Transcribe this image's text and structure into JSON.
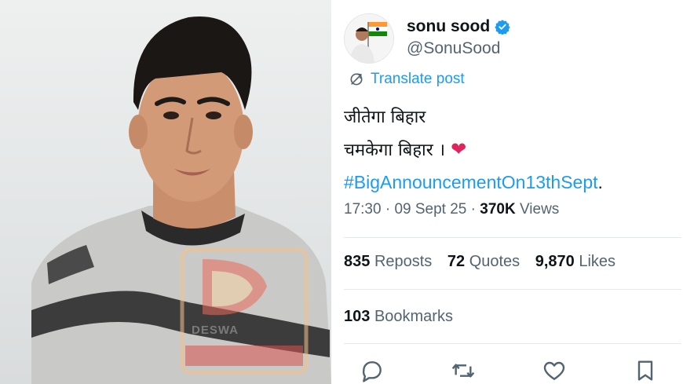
{
  "photo": {
    "watermark_text": "DESWA"
  },
  "tweet": {
    "author": {
      "display_name": "sonu sood",
      "handle": "@SonuSood",
      "verified": true
    },
    "translate_label": "Translate post",
    "lines": {
      "line1": "जीतेगा बिहार",
      "line2": "चमकेगा बिहार ।",
      "hashtag": "#BigAnnouncementOn13thSept",
      "hashtag_suffix": "."
    },
    "meta": {
      "time": "17:30",
      "date": "09 Sept 25",
      "views_count": "370K",
      "views_label": "Views",
      "separator": "·"
    },
    "stats": {
      "reposts_count": "835",
      "reposts_label": "Reposts",
      "quotes_count": "72",
      "quotes_label": "Quotes",
      "likes_count": "9,870",
      "likes_label": "Likes",
      "bookmarks_count": "103",
      "bookmarks_label": "Bookmarks"
    },
    "colors": {
      "accent": "#1d9bf0",
      "secondary_text": "#536471",
      "primary_text": "#0f1419",
      "heart": "#e0245e"
    },
    "actions": [
      "reply-icon",
      "repost-icon",
      "like-icon",
      "bookmark-icon"
    ]
  }
}
